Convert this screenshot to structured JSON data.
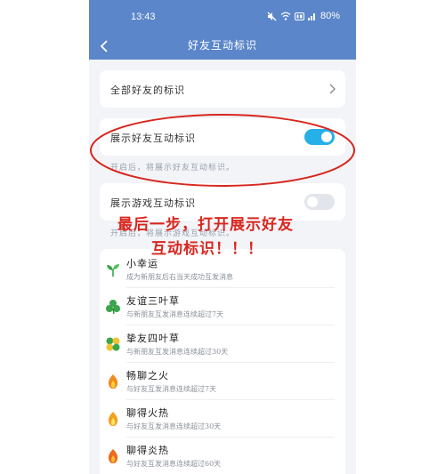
{
  "status_bar": {
    "time": "13:43",
    "battery": "80%",
    "icons": [
      "mute-icon",
      "wifi-icon",
      "hd-icon",
      "signal-icon"
    ]
  },
  "nav": {
    "title": "好友互动标识",
    "back_icon": "chevron-left-icon"
  },
  "all_friends_row": {
    "label": "全部好友的标识"
  },
  "show_friend_row": {
    "label": "展示好友互动标识",
    "enabled": true,
    "hint": "开启后，将展示好友互动标识。"
  },
  "show_game_row": {
    "label": "展示游戏互动标识",
    "enabled": false,
    "hint": "开启后，将展示游戏互动标识。"
  },
  "annotation": {
    "line1": "最后一步，打开展示好友",
    "line2": "互动标识！！！",
    "color": "#d8261e"
  },
  "badges": [
    {
      "name": "小幸运",
      "desc": "成为新朋友后右当天成功互发消息",
      "icon": "sprout-icon"
    },
    {
      "name": "友谊三叶草",
      "desc": "与新朋友互发消息连续超过7天",
      "icon": "three-leaf-clover-icon"
    },
    {
      "name": "挚友四叶草",
      "desc": "与新朋友互发消息连续超过30天",
      "icon": "four-leaf-clover-icon"
    },
    {
      "name": "畅聊之火",
      "desc": "与好友互发消息连续超过7天",
      "icon": "flame-icon"
    },
    {
      "name": "聊得火热",
      "desc": "与好友互发消息连续超过30天",
      "icon": "flame-icon"
    },
    {
      "name": "聊得炎热",
      "desc": "与好友互发消息连续超过60天",
      "icon": "flame-icon"
    }
  ],
  "colors": {
    "header": "#5b86c9",
    "toggle_on": "#27b0e8",
    "toggle_off": "#e2e5ec",
    "background": "#f2f4f8"
  }
}
